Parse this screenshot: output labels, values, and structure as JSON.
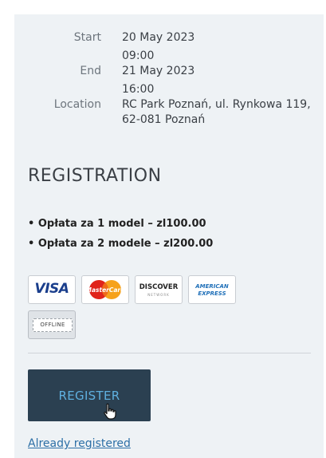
{
  "event": {
    "start_label": "Start",
    "start_date": "20 May 2023",
    "start_time": "09:00",
    "end_label": "End",
    "end_date": "21 May 2023",
    "end_time": "16:00",
    "location_label": "Location",
    "location_value": "RC Park Poznań, ul. Rynkowa 119, 62-081 Poznań"
  },
  "registration": {
    "title": "REGISTRATION",
    "fees": [
      "• Opłata za 1 model – zl100.00",
      "• Opłata za 2 modele – zl200.00"
    ],
    "payment_methods": {
      "visa": "VISA",
      "mastercard": "MasterCard",
      "discover": "DISCOVER",
      "discover_sub": "NETWORK",
      "amex_line1": "AMERICAN",
      "amex_line2": "EXPRESS",
      "offline": "OFFLINE"
    },
    "register_button": "REGISTER",
    "already_registered_link": "Already registered"
  },
  "colors": {
    "panel_bg": "#eef2f5",
    "button_bg": "#2b4051",
    "button_text": "#5fb0e0",
    "link": "#2d6fa6"
  },
  "icons": {
    "cursor": "hand-pointer-icon"
  }
}
